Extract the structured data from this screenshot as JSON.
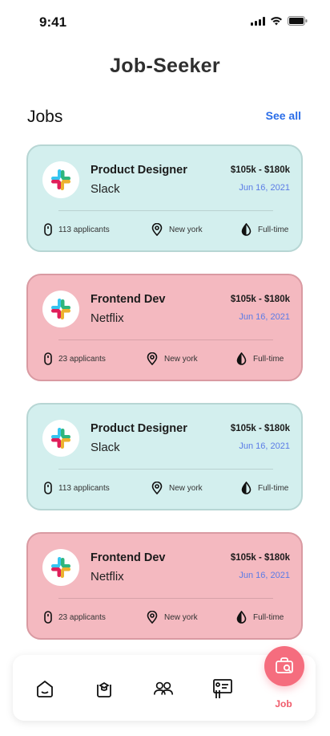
{
  "status": {
    "time": "9:41"
  },
  "header": {
    "title": "Job-Seeker"
  },
  "section": {
    "title": "Jobs",
    "see_all": "See all"
  },
  "jobs": [
    {
      "title": "Product Designer",
      "company": "Slack",
      "salary": "$105k - $180k",
      "date": "Jun 16, 2021",
      "applicants": "113 applicants",
      "location": "New york",
      "type": "Full-time",
      "theme": "teal"
    },
    {
      "title": "Frontend Dev",
      "company": "Netflix",
      "salary": "$105k - $180k",
      "date": "Jun 16, 2021",
      "applicants": "23 applicants",
      "location": "New york",
      "type": "Full-time",
      "theme": "pink"
    },
    {
      "title": "Product Designer",
      "company": "Slack",
      "salary": "$105k - $180k",
      "date": "Jun 16, 2021",
      "applicants": "113 applicants",
      "location": "New york",
      "type": "Full-time",
      "theme": "teal"
    },
    {
      "title": "Frontend Dev",
      "company": "Netflix",
      "salary": "$105k - $180k",
      "date": "Jun 16, 2021",
      "applicants": "23 applicants",
      "location": "New york",
      "type": "Full-time",
      "theme": "pink"
    }
  ],
  "nav": {
    "items": [
      "home-icon",
      "graduation-icon",
      "people-icon",
      "presentation-icon"
    ],
    "active_label": "Job",
    "active_icon": "briefcase-search-icon"
  },
  "colors": {
    "teal_card": "#d3efee",
    "pink_card": "#f4b9c0",
    "accent": "#f56d7e",
    "link": "#2a6de8",
    "date": "#5a7be6"
  }
}
